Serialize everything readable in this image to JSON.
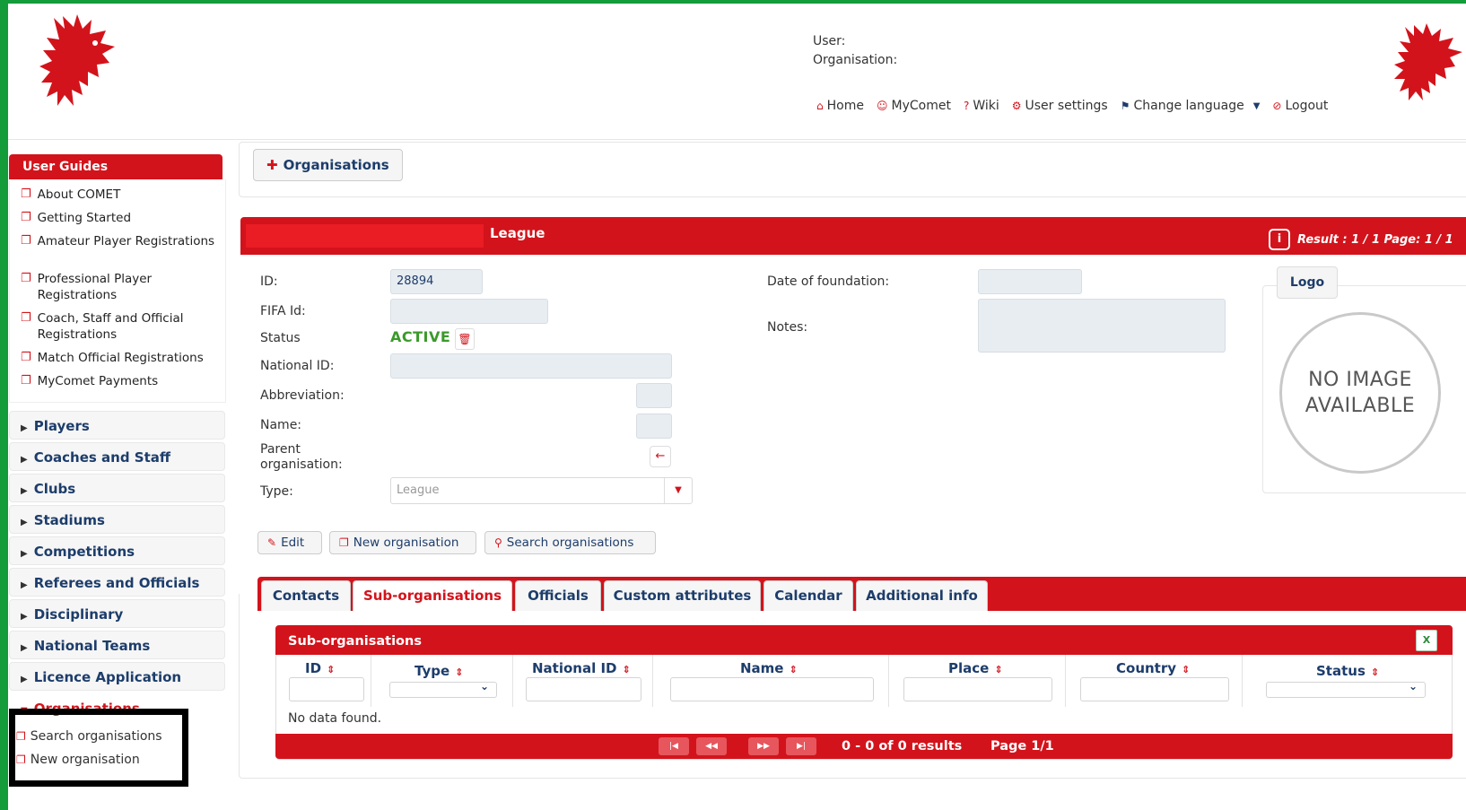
{
  "header": {
    "user_label": "User:",
    "organisation_label": "Organisation:",
    "nav": [
      {
        "icon": "home-icon",
        "glyph": "⌂",
        "label": "Home"
      },
      {
        "icon": "user-icon",
        "glyph": "☺",
        "label": "MyComet"
      },
      {
        "icon": "help-icon",
        "glyph": "?",
        "label": "Wiki"
      },
      {
        "icon": "gear-icon",
        "glyph": "⚙",
        "label": "User settings"
      },
      {
        "icon": "uk-flag-icon",
        "glyph": "⚑",
        "label": "Change language"
      },
      {
        "icon": "logout-icon",
        "glyph": "⊘",
        "label": "Logout"
      }
    ]
  },
  "sidebar": {
    "user_guides_title": "User Guides",
    "guides": [
      "About COMET",
      "Getting Started",
      "Amateur Player Registrations",
      "Professional Player Registrations",
      "Coach, Staff and Official Registrations",
      "Match Official Registrations",
      "MyComet Payments"
    ],
    "menu": [
      "Players",
      "Coaches and Staff",
      "Clubs",
      "Stadiums",
      "Competitions",
      "Referees and Officials",
      "Disciplinary",
      "National Teams",
      "Licence Application",
      "Organisations"
    ],
    "sub_items": [
      "Search organisations",
      "New organisation"
    ]
  },
  "main": {
    "organisations_button": "Organisations",
    "league_title": "League",
    "result_text": "Result : 1 / 1 Page: 1 / 1",
    "labels": {
      "id": "ID:",
      "fifa_id": "FIFA Id:",
      "status": "Status",
      "national_id": "National ID:",
      "abbreviation": "Abbreviation:",
      "name": "Name:",
      "parent": "Parent organisation:",
      "type": "Type:",
      "date_of_foundation": "Date of foundation:",
      "notes": "Notes:"
    },
    "values": {
      "id": "28894",
      "status": "ACTIVE",
      "type": "League"
    },
    "logo_label": "Logo",
    "no_image": "NO IMAGE AVAILABLE",
    "actions": [
      "Edit",
      "New organisation",
      "Search organisations"
    ],
    "tabs": [
      "Contacts",
      "Sub-organisations",
      "Officials",
      "Custom attributes",
      "Calendar",
      "Additional info"
    ],
    "active_tab": "Sub-organisations",
    "sub_table": {
      "title": "Sub-organisations",
      "columns": [
        "ID",
        "Type",
        "National ID",
        "Name",
        "Place",
        "Country",
        "Status"
      ],
      "empty_text": "No data found.",
      "pager_results": "0 - 0 of 0 results",
      "pager_page": "Page 1/1"
    }
  },
  "colors": {
    "brand_red": "#d3131b",
    "navy": "#1d3d6b",
    "active_green": "#3a9a2a",
    "frame_green": "#149b3a"
  }
}
